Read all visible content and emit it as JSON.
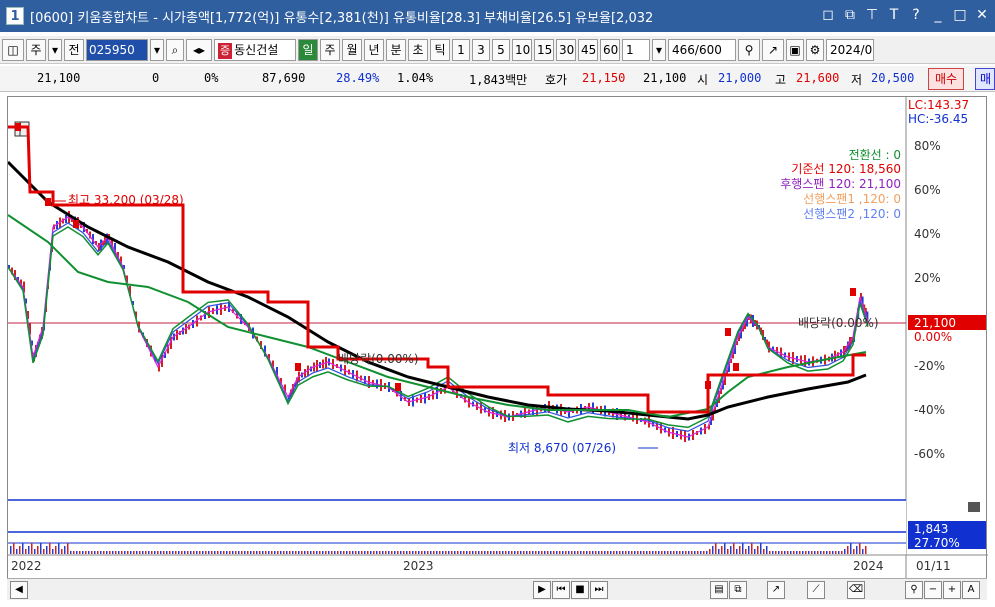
{
  "window": {
    "number": "1",
    "title": "[0600] 키움종합차트 - 시가총액[1,772(억)] 유통수[2,381(천)] 유통비율[28.3] 부채비율[26.5] 유보율[2,032"
  },
  "toolbar": {
    "period_main": "주",
    "prev_label": "전",
    "code": "025950",
    "stock_tag": "증",
    "stock_name": "동신건설",
    "periods": [
      "일",
      "주",
      "월",
      "년",
      "분",
      "초",
      "틱"
    ],
    "active_period": "일",
    "intervals": [
      "1",
      "3",
      "5",
      "10",
      "15",
      "30",
      "45",
      "60"
    ],
    "count_value": "1",
    "range_current": "466",
    "range_total": "/600",
    "date": "2024/0"
  },
  "quote": {
    "price": "21,100",
    "change": "0",
    "change_pct": "0%",
    "volume": "87,690",
    "turnover_pct": "28.49%",
    "ratio": "1.04%",
    "amount": "1,843백만",
    "bid_label": "호가",
    "ask_price": "21,150",
    "bid_price": "21,100",
    "open_label": "시",
    "open": "21,000",
    "high_label": "고",
    "high": "21,600",
    "low_label": "저",
    "low": "20,500",
    "buy_label": "매수",
    "sell_label": "매"
  },
  "chart": {
    "lc": "LC:143.37",
    "hc": "HC:-36.45",
    "y_ticks": [
      "80%",
      "60%",
      "40%",
      "20%",
      "0.00%",
      "-20%",
      "-40%",
      "-60%"
    ],
    "legend": [
      {
        "label": "전환선 : 0",
        "color": "#109030"
      },
      {
        "label": "기준선 120: 18,560",
        "color": "#e00000"
      },
      {
        "label": "후행스팬 120: 21,100",
        "color": "#9020c0"
      },
      {
        "label": "선행스팬1 ,120: 0",
        "color": "#f0a060"
      },
      {
        "label": "선행스팬2 ,120: 0",
        "color": "#6080f0"
      }
    ],
    "high_annotation": "최고 33,200 (03/28)",
    "low_annotation": "최저 8,670 (07/26)",
    "ex_dividend_1": "배당락(0.00%)",
    "ex_dividend_2": "배당락(0.00%)",
    "current_price_tag": "21,100",
    "volume_tag": "1,843",
    "volume_pct_tag": "27.70%",
    "x_labels": [
      "2022",
      "2023",
      "2024"
    ],
    "x_right_label": "01/11",
    "colors": {
      "baseline": "#e00000",
      "ma_long": "#000000",
      "ma_green": "#109030",
      "price_tag_bg": "#e00000",
      "volume_tag_bg": "#1030d0"
    }
  }
}
